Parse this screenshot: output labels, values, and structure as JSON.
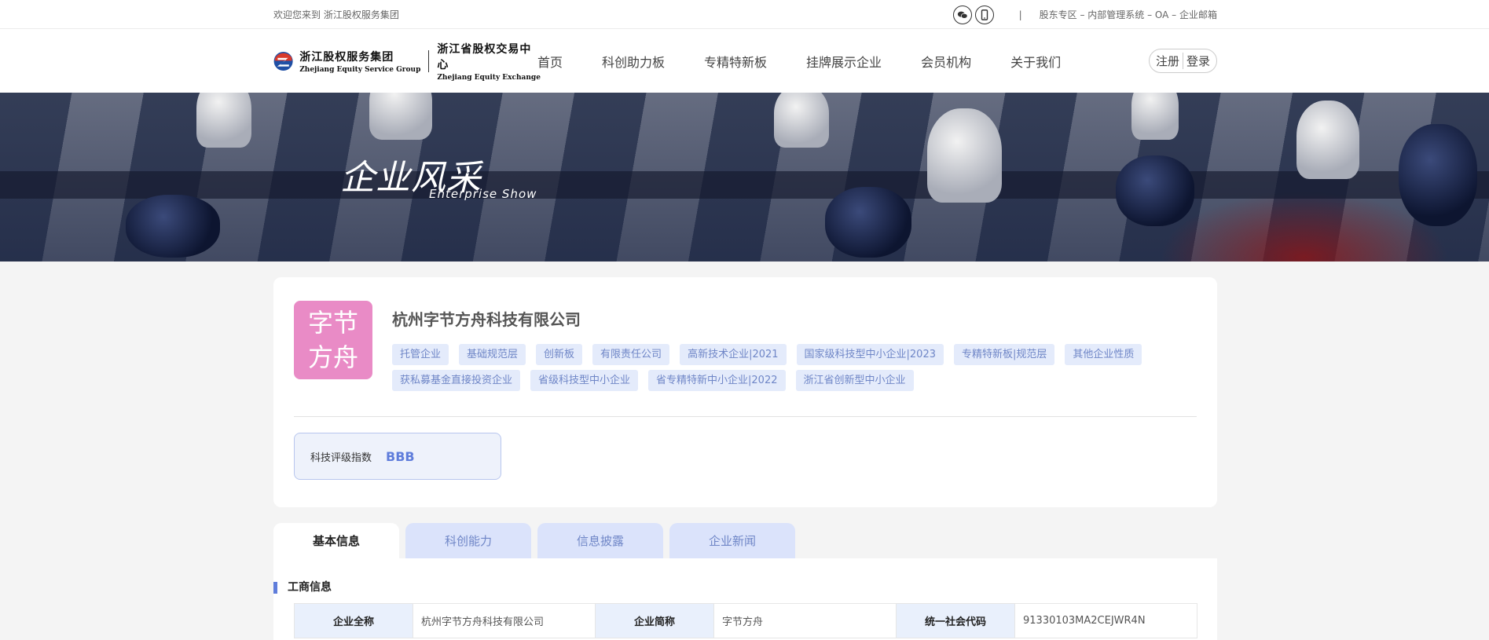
{
  "topbar": {
    "welcome": "欢迎您来到 浙江股权服务集团",
    "separator": "|",
    "links": "股东专区 – 内部管理系统 – OA – 企业邮箱"
  },
  "header": {
    "logo": {
      "cn1": "浙江股权服务集团",
      "en1": "Zhejiang Equity Service Group",
      "cn2": "浙江省股权交易中心",
      "en2": "Zhejiang Equity Exchange"
    },
    "nav": [
      "首页",
      "科创助力板",
      "专精特新板",
      "挂牌展示企业",
      "会员机构",
      "关于我们"
    ],
    "register": "注册",
    "login": "登录"
  },
  "banner": {
    "title": "企业风采",
    "subtitle": "Enterprise  Show"
  },
  "company": {
    "avatar_text": "字节方舟",
    "name": "杭州字节方舟科技有限公司",
    "tags": [
      "托管企业",
      "基础规范层",
      "创新板",
      "有限责任公司",
      "高新技术企业|2021",
      "国家级科技型中小企业|2023",
      "专精特新板|规范层",
      "其他企业性质",
      "获私募基金直接投资企业",
      "省级科技型中小企业",
      "省专精特新中小企业|2022",
      "浙江省创新型中小企业"
    ],
    "rating_label": "科技评级指数",
    "rating_value": "BBB"
  },
  "tabs": [
    "基本信息",
    "科创能力",
    "信息披露",
    "企业新闻"
  ],
  "section": {
    "title": "工商信息",
    "row": [
      {
        "label": "企业全称",
        "value": "杭州字节方舟科技有限公司"
      },
      {
        "label": "企业简称",
        "value": "字节方舟"
      },
      {
        "label": "统一社会代码",
        "value": "91330103MA2CEJWR4N"
      }
    ]
  },
  "colors": {
    "accent": "#5f7ddb",
    "tag_bg": "#e4ebfb",
    "avatar": "#e98bc6"
  }
}
